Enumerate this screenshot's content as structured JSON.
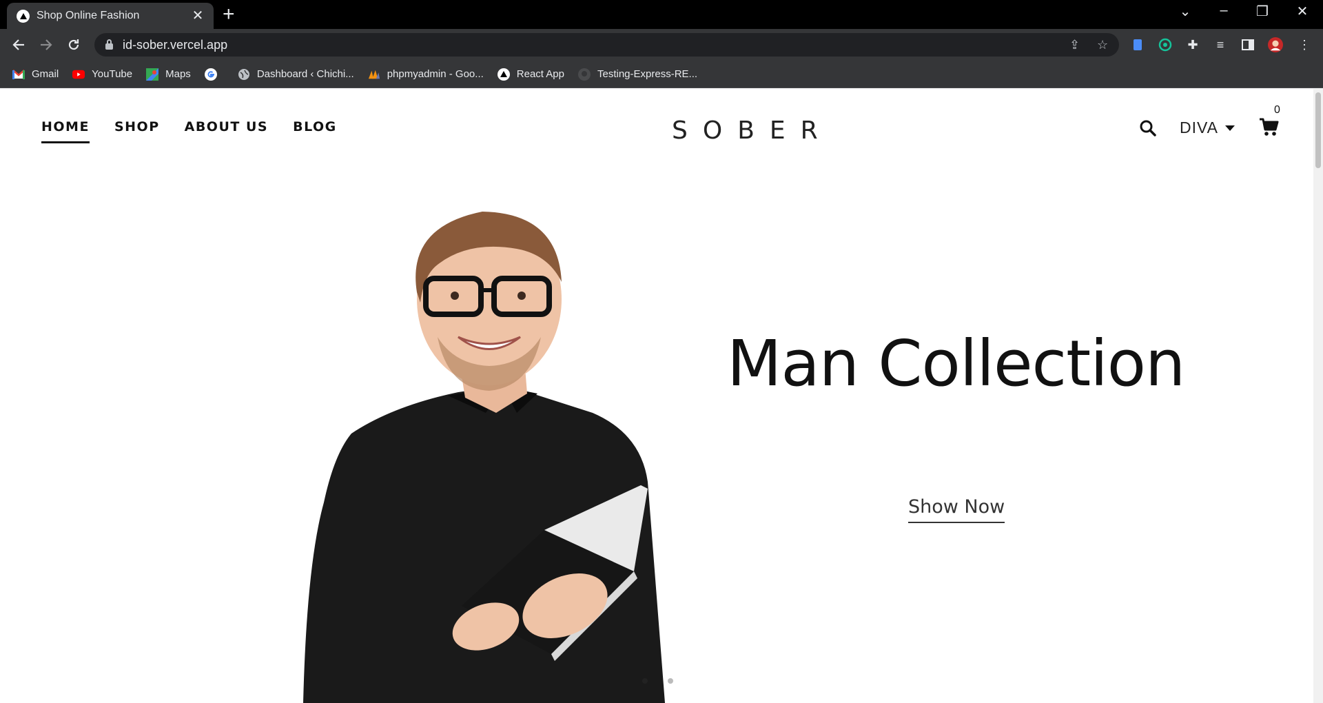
{
  "browser": {
    "tab_title": "Shop Online Fashion",
    "tab_close": "✕",
    "new_tab": "+",
    "url": "id-sober.vercel.app",
    "bookmarks": [
      {
        "label": "Gmail",
        "icon": "gmail-icon",
        "color": "#ea4335"
      },
      {
        "label": "YouTube",
        "icon": "youtube-icon",
        "color": "#ff0000"
      },
      {
        "label": "Maps",
        "icon": "maps-icon",
        "color": "#34a853"
      },
      {
        "label": "",
        "icon": "google-icon",
        "color": "#ffffff"
      },
      {
        "label": "Dashboard ‹ Chichi...",
        "icon": "globe-icon",
        "color": "#bdc1c6"
      },
      {
        "label": "phpmyadmin - Goo...",
        "icon": "phpmyadmin-icon",
        "color": "#f29111"
      },
      {
        "label": "React App",
        "icon": "vercel-icon",
        "color": "#ffffff"
      },
      {
        "label": "Testing-Express-RE...",
        "icon": "github-icon",
        "color": "#4a4b4d"
      }
    ]
  },
  "site": {
    "nav": [
      {
        "label": "HOME",
        "active": true
      },
      {
        "label": "SHOP",
        "active": false
      },
      {
        "label": "ABOUT US",
        "active": false
      },
      {
        "label": "BLOG",
        "active": false
      }
    ],
    "logo": "SOBER",
    "user_name": "DIVA",
    "cart_count": "0"
  },
  "hero": {
    "title": "Man Collection",
    "cta_label": "Show Now",
    "slides_total": 2,
    "slide_active": 1
  },
  "colors": {
    "chrome_dark": "#000000",
    "chrome_toolbar": "#353638",
    "text_dark": "#111111"
  }
}
